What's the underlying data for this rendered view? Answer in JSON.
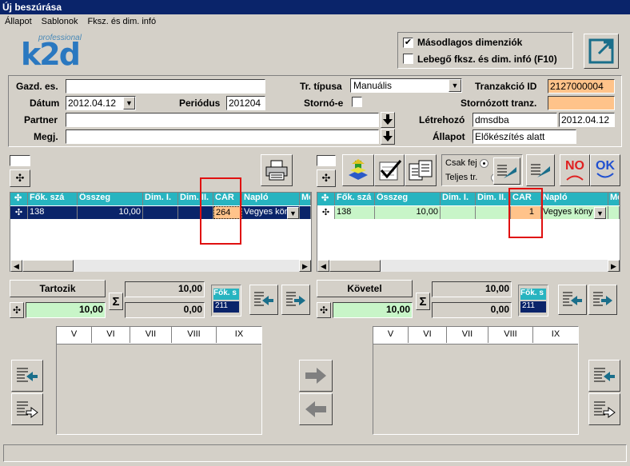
{
  "window": {
    "title": "Új beszúrása"
  },
  "menu": [
    "Állapot",
    "Sablonok",
    "Fksz. és dim. infó"
  ],
  "logo": {
    "small": "professional",
    "main": "k2d"
  },
  "options": {
    "secondary_dim_label": "Másodlagos dimenziók",
    "secondary_dim_checked": "✔",
    "floating_info_label": "Lebegő fksz. és dim. infó  (F10)",
    "floating_info_checked": ""
  },
  "header": {
    "gazd_label": "Gazd. es.",
    "gazd_value": "",
    "datum_label": "Dátum",
    "datum_value": "2012.04.12",
    "periodus_label": "Periódus",
    "periodus_value": "201204",
    "partner_label": "Partner",
    "partner_value": "",
    "megj_label": "Megj.",
    "megj_value": "",
    "tr_tipus_label": "Tr. típusa",
    "tr_tipus_value": "Manuális",
    "storno_label": "Stornó-e",
    "tranzakcio_label": "Tranzakció ID",
    "tranzakcio_value": "2127000004",
    "stornozott_label": "Stornózott tranz.",
    "stornozott_value": "",
    "letrehozo_label": "Létrehozó",
    "letrehozo_user": "dmsdba",
    "letrehozo_date": "2012.04.12",
    "allapot_label": "Állapot",
    "allapot_value": "Előkészítés alatt"
  },
  "grid_columns": [
    "Fők. szá",
    "Összeg",
    "Dim. I.",
    "Dim. II.",
    "CAR",
    "Napló",
    "Me"
  ],
  "left_row": {
    "fok": "138",
    "osszeg": "10,00",
    "dim1": "",
    "dim2": "",
    "car": "264",
    "naplo": "Vegyes köny"
  },
  "right_row": {
    "fok": "138",
    "osszeg": "10,00",
    "dim1": "",
    "dim2": "",
    "car": "1",
    "naplo": "Vegyes köny"
  },
  "toolbar": {
    "csak_fej": "Csak fej",
    "teljes_tr": "Teljes tr.",
    "no_label": "NO",
    "ok_label": "OK"
  },
  "left_summary": {
    "title": "Tartozik",
    "total": "10,00",
    "sum1": "10,00",
    "sum2": "0,00",
    "fok_label": "Fők. s",
    "fok_value": "211"
  },
  "right_summary": {
    "title": "Követel",
    "total": "10,00",
    "sum1": "10,00",
    "sum2": "0,00",
    "fok_label": "Fők. s",
    "fok_value": "211"
  },
  "dim_tabs": [
    "V",
    "VI",
    "VII",
    "VIII",
    "IX"
  ],
  "sigma": "Σ",
  "plus": "✣"
}
